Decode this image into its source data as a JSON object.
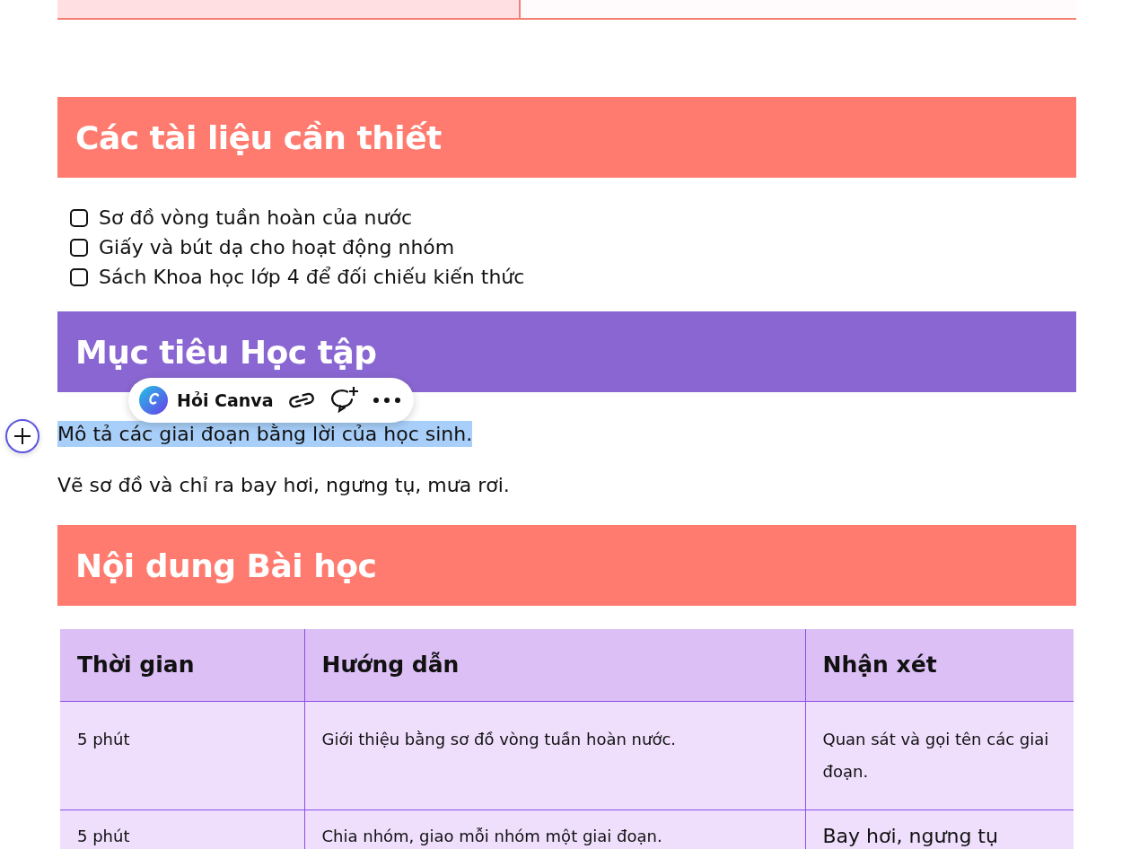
{
  "materials": {
    "title": "Các tài liệu cần thiết",
    "items": [
      {
        "label": "Sơ đồ vòng tuần hoàn của nước",
        "checked": false
      },
      {
        "label": "Giấy và bút dạ cho hoạt động nhóm",
        "checked": false
      },
      {
        "label": "Sách Khoa học lớp 4 để đối chiếu kiến thức",
        "checked": false
      }
    ]
  },
  "objectives": {
    "title": "Mục tiêu Học tập",
    "paragraphs": [
      {
        "text": "Mô tả các giai đoạn bằng lời của học sinh.",
        "selected": true
      },
      {
        "text": "Vẽ sơ đồ và chỉ ra bay hơi, ngưng tụ, mưa rơi.",
        "selected": false
      }
    ]
  },
  "toolbar": {
    "ask_label": "Hỏi Canva"
  },
  "content": {
    "title": "Nội dung Bài học",
    "columns": [
      "Thời gian",
      "Hướng dẫn",
      "Nhận xét"
    ],
    "rows": [
      [
        "5 phút",
        "Giới thiệu bằng sơ đồ vòng tuần hoàn nước.",
        "Quan sát và gọi tên các giai đoạn."
      ],
      [
        "5 phút",
        "Chia nhóm, giao mỗi nhóm một giai đoạn.",
        "Bay hơi, ngưng tụ"
      ]
    ]
  }
}
